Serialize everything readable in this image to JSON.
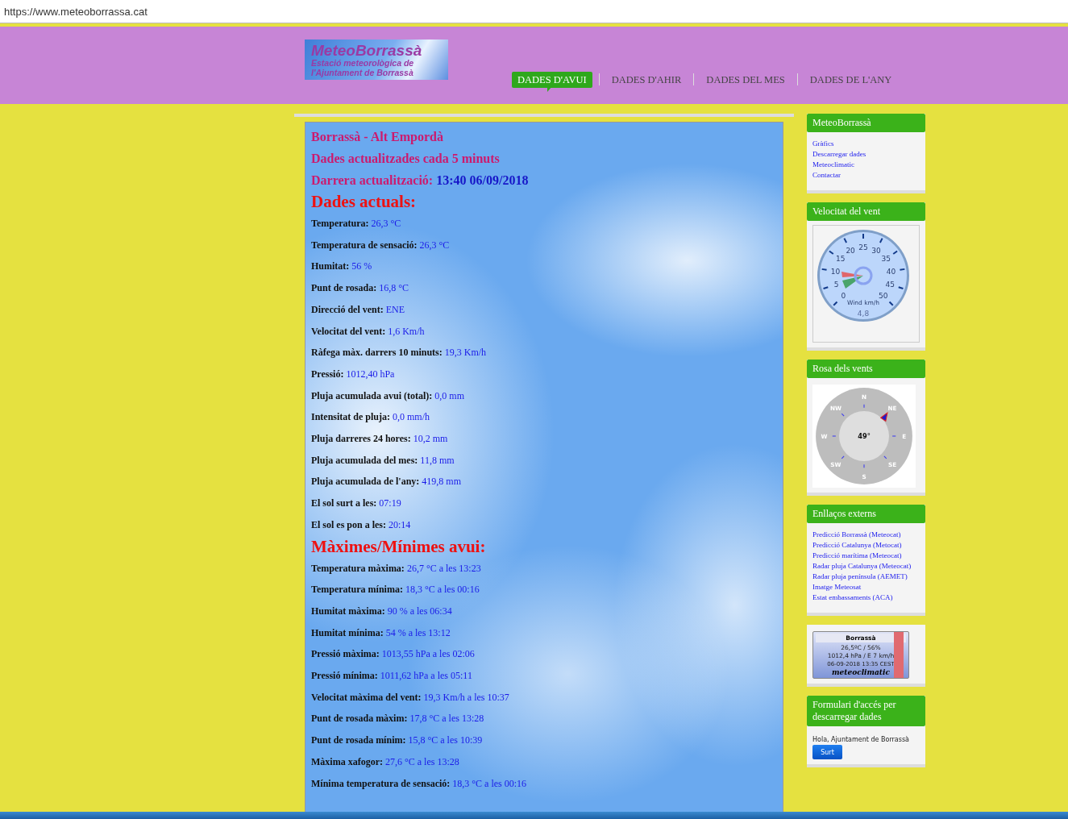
{
  "address_bar": {
    "url": "https://www.meteoborrassa.cat"
  },
  "header": {
    "logo": {
      "title": "MeteoBorrassà",
      "subtitle_1": "Estació meteorològica de",
      "subtitle_2": "l'Ajuntament de Borrassà"
    },
    "nav": [
      {
        "label": "DADES D'AVUI",
        "selected": true
      },
      {
        "label": "DADES D'AHIR",
        "selected": false
      },
      {
        "label": "DADES DEL MES",
        "selected": false
      },
      {
        "label": "DADES DE L'ANY",
        "selected": false
      }
    ]
  },
  "main": {
    "location": "Borrassà - Alt Empordà",
    "update_note": "Dades actualitzades cada 5 minuts",
    "last_update": {
      "label": "Darrera actualització:",
      "value": "13:40 06/09/2018"
    },
    "current_title": "Dades actuals:",
    "current": [
      {
        "label": "Temperatura:",
        "value": "26,3 °C"
      },
      {
        "label": "Temperatura de sensació:",
        "value": "26,3 °C"
      },
      {
        "label": "Humitat:",
        "value": "56 %"
      },
      {
        "label": "Punt de rosada:",
        "value": "16,8 °C"
      },
      {
        "label": "Direcció del vent:",
        "value": "ENE"
      },
      {
        "label": "Velocitat del vent:",
        "value": "1,6 Km/h"
      },
      {
        "label": "Ràfega màx. darrers 10 minuts:",
        "value": "19,3 Km/h"
      },
      {
        "label": "Pressió:",
        "value": "1012,40 hPa"
      },
      {
        "label": "Pluja acumulada avui (total):",
        "value": "0,0 mm"
      },
      {
        "label": "Intensitat de pluja:",
        "value": "0,0 mm/h"
      },
      {
        "label": "Pluja darreres 24 hores:",
        "value": "10,2 mm"
      },
      {
        "label": "Pluja acumulada del mes:",
        "value": "11,8 mm"
      },
      {
        "label": "Pluja acumulada de l'any:",
        "value": "419,8 mm"
      },
      {
        "label": "El sol surt a les:",
        "value": "07:19"
      },
      {
        "label": "El sol es pon a les:",
        "value": "20:14"
      }
    ],
    "minmax_title": "Màximes/Mínimes avui:",
    "minmax": [
      {
        "label": "Temperatura màxima:",
        "value": "26,7 °C a les 13:23"
      },
      {
        "label": "Temperatura mínima:",
        "value": "18,3 °C a les 00:16"
      },
      {
        "label": "Humitat màxima:",
        "value": "90 % a les 06:34"
      },
      {
        "label": "Humitat mínima:",
        "value": "54 % a les 13:12"
      },
      {
        "label": "Pressió màxima:",
        "value": "1013,55 hPa a les 02:06"
      },
      {
        "label": "Pressió mínima:",
        "value": "1011,62 hPa a les 05:11"
      },
      {
        "label": "Velocitat màxima del vent:",
        "value": "19,3 Km/h a les 10:37"
      },
      {
        "label": "Punt de rosada màxim:",
        "value": "17,8 °C a les 13:28"
      },
      {
        "label": "Punt de rosada mínim:",
        "value": "15,8 °C a les 10:39"
      },
      {
        "label": "Màxima xafogor:",
        "value": "27,6 °C a les 13:28"
      },
      {
        "label": "Mínima temperatura de sensació:",
        "value": "18,3 °C a les 00:16"
      }
    ]
  },
  "sidebar": [
    {
      "kind": "links",
      "title": "MeteoBorrassà",
      "links": [
        "Gràfics",
        "Descarregar dades",
        "Meteoclimatic",
        "Contactar"
      ]
    },
    {
      "kind": "gauge",
      "title": "Velocitat del vent",
      "tick_labels": [
        "20",
        "25",
        "30",
        "15",
        "35",
        "10",
        "40",
        "5",
        "45",
        "0",
        "50"
      ],
      "unit_label": "Wind km/h",
      "reading": "4,8"
    },
    {
      "kind": "compass",
      "title": "Rosa dels vents",
      "directions": [
        "N",
        "NE",
        "E",
        "SE",
        "S",
        "SW",
        "W",
        "NW"
      ],
      "reading": "49°"
    },
    {
      "kind": "links",
      "title": "Enllaços externs",
      "links": [
        "Predicció Borrassà (Meteocat)",
        "Predicció Catalunya (Metocat)",
        "Predicció marítima (Meteocat)",
        "Radar pluja Catalunya (Meteocat)",
        "Radar pluja península (AEMET)",
        "Imatge Meteosat",
        "Estat embassaments (ACA)"
      ]
    },
    {
      "kind": "badge",
      "station": "Borrassà",
      "lines": [
        "26,5ºC / 56%",
        "1012,4 hPa / E 7 km/h",
        "06-09-2018 13:35 CEST"
      ],
      "brand": "meteoclimatic"
    },
    {
      "kind": "login",
      "title": "Formulari d'accés per descarregar dades",
      "greeting": "Hola, Ajuntament de Borrassà",
      "button": "Surt"
    }
  ]
}
